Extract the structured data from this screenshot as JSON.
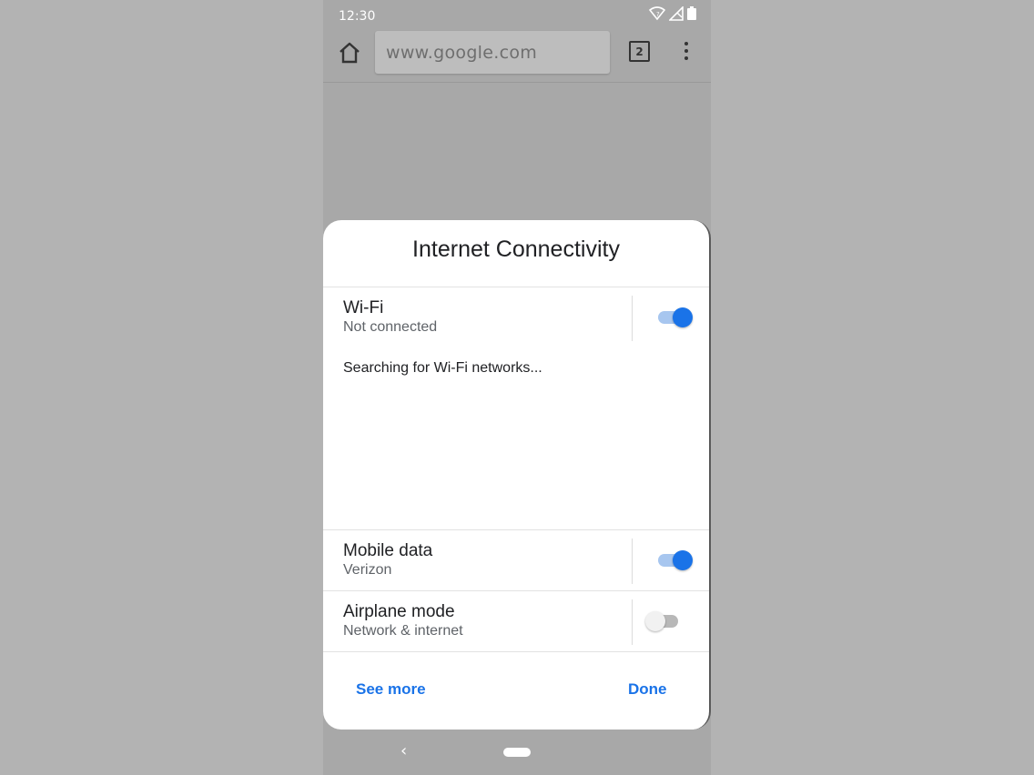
{
  "status_bar": {
    "time": "12:30",
    "icons": [
      "wifi-icon",
      "signal-icon",
      "battery-icon"
    ]
  },
  "browser_toolbar": {
    "home_icon": "home-icon",
    "url": "www.google.com",
    "tab_count": "2",
    "menu_icon": "more-vert-icon"
  },
  "dialog": {
    "title": "Internet Connectivity",
    "wifi": {
      "title": "Wi-Fi",
      "subtitle": "Not connected",
      "enabled": true,
      "status_text": "Searching for Wi-Fi networks..."
    },
    "mobile_data": {
      "title": "Mobile data",
      "subtitle": "Verizon",
      "enabled": true
    },
    "airplane_mode": {
      "title": "Airplane mode",
      "subtitle": "Network & internet",
      "enabled": false
    },
    "see_more_label": "See more",
    "done_label": "Done"
  },
  "nav_bar": {
    "back_glyph": "‹",
    "back_icon": "back-icon",
    "home_icon": "home-pill-icon"
  },
  "colors": {
    "accent": "#1a73e8",
    "dim_background": "#a8a8a8"
  }
}
